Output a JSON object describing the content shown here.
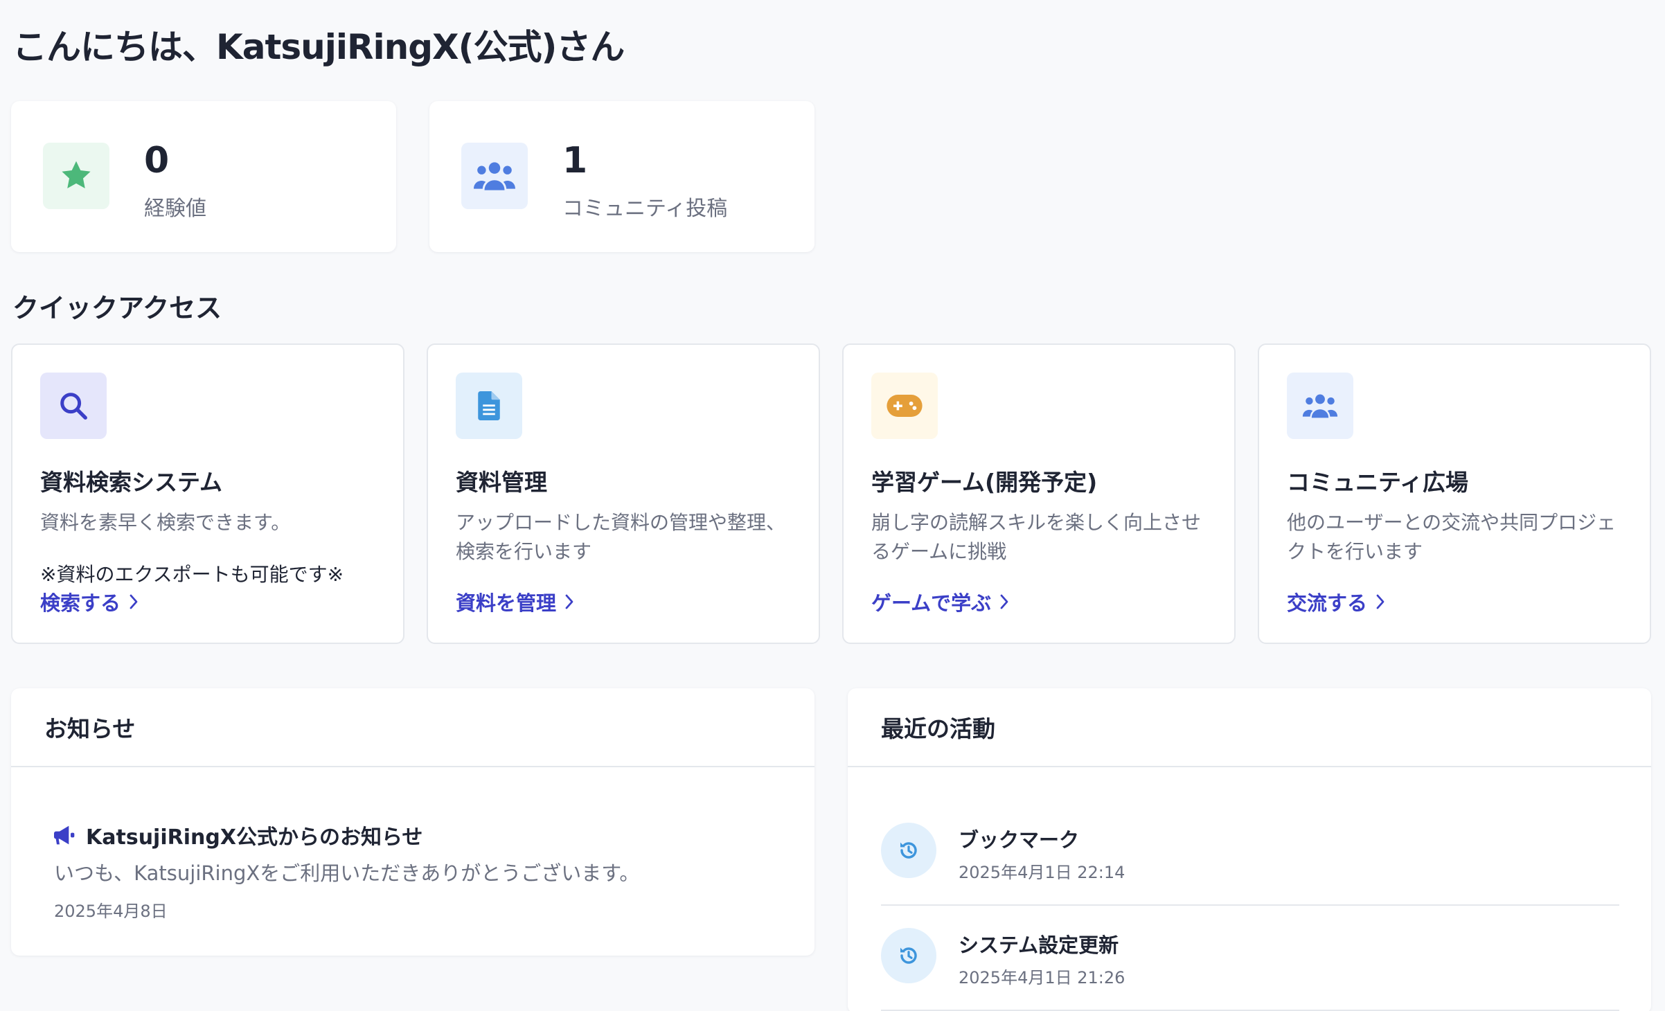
{
  "greeting": "こんにちは、KatsujiRingX(公式)さん",
  "stats": [
    {
      "value": "0",
      "label": "経験値",
      "icon": "star-icon",
      "color": "#4cb87a",
      "bg": "#ebf8f0"
    },
    {
      "value": "1",
      "label": "コミュニティ投稿",
      "icon": "users-icon",
      "color": "#4f7de0",
      "bg": "#eaf1fd"
    }
  ],
  "quick_access": {
    "title": "クイックアクセス",
    "cards": [
      {
        "title": "資料検索システム",
        "description": "資料を素早く検索できます。",
        "note": "※資料のエクスポートも可能です※",
        "link": "検索する",
        "icon": "search-icon",
        "color": "#3b3fc7",
        "bg": "#e5e6fb"
      },
      {
        "title": "資料管理",
        "description": "アップロードした資料の管理や整理、検索を行います",
        "note": "",
        "link": "資料を管理",
        "icon": "document-icon",
        "color": "#3d95dc",
        "bg": "#e2f0fc"
      },
      {
        "title": "学習ゲーム(開発予定)",
        "description": "崩し字の読解スキルを楽しく向上させるゲームに挑戦",
        "note": "",
        "link": "ゲームで学ぶ",
        "icon": "gamepad-icon",
        "color": "#e59f3a",
        "bg": "#fff8e8"
      },
      {
        "title": "コミュニティ広場",
        "description": "他のユーザーとの交流や共同プロジェクトを行います",
        "note": "",
        "link": "交流する",
        "icon": "users-icon",
        "color": "#4f7de0",
        "bg": "#eaf1fd"
      }
    ]
  },
  "notices": {
    "title": "お知らせ",
    "item": {
      "title": "KatsujiRingX公式からのお知らせ",
      "body": "いつも、KatsujiRingXをご利用いただきありがとうございます。",
      "date": "2025年4月8日",
      "icon": "megaphone-icon",
      "color": "#3b3fc7"
    }
  },
  "activity": {
    "title": "最近の活動",
    "items": [
      {
        "title": "ブックマーク",
        "time": "2025年4月1日 22:14",
        "icon": "history-icon"
      },
      {
        "title": "システム設定更新",
        "time": "2025年4月1日 21:26",
        "icon": "history-icon"
      }
    ]
  },
  "colors": {
    "link": "#3b3fc7",
    "text": "#1f2433",
    "muted": "#6b7080",
    "background": "#f8f9fb"
  }
}
